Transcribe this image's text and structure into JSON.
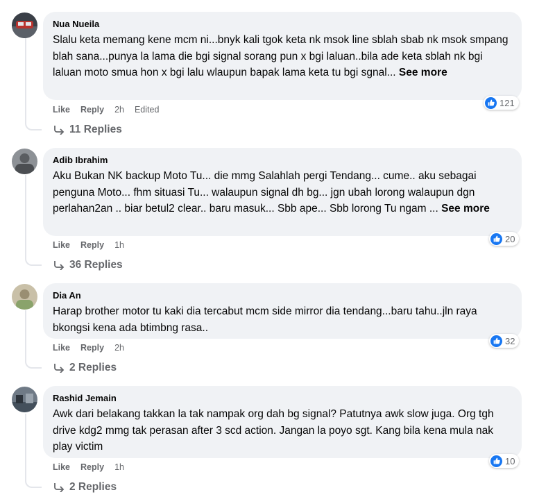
{
  "action_labels": {
    "like": "Like",
    "reply": "Reply"
  },
  "comments": [
    {
      "author": "Nua Nueila",
      "text": "Slalu keta memang kene mcm ni...bnyk kali tgok keta nk msok line sblah sbab nk msok smpang blah sana...punya la lama die bgi signal sorang pun x bgi laluan..bila ade keta sblah nk bgi laluan moto smua hon x bgi lalu wlaupun bapak lama keta tu bgi sgnal...",
      "see_more": "See more",
      "time": "2h",
      "edited": "Edited",
      "reactions": "121",
      "replies": "11 Replies"
    },
    {
      "author": "Adib Ibrahim",
      "text": "Aku Bukan NK backup Moto Tu... die mmg Salahlah pergi Tendang... cume.. aku sebagai penguna Moto... fhm situasi Tu... walaupun signal dh bg... jgn ubah lorong walaupun dgn perlahan2an .. biar betul2 clear.. baru masuk... Sbb ape... Sbb lorong Tu ngam ...",
      "see_more": "See more",
      "time": "1h",
      "reactions": "20",
      "replies": "36 Replies"
    },
    {
      "author": "Dia An",
      "text": "Harap brother motor tu kaki dia tercabut mcm side mirror dia tendang...baru tahu..jln raya bkongsi kena ada btimbng rasa..",
      "time": "2h",
      "reactions": "32",
      "replies": "2 Replies"
    },
    {
      "author": "Rashid Jemain",
      "text": "Awk dari belakang takkan la tak nampak org dah bg signal? Patutnya awk slow juga. Org tgh drive kdg2 mmg tak perasan after 3 scd action. Jangan la poyo sgt. Kang bila kena mula nak play victim",
      "time": "1h",
      "reactions": "10",
      "replies": "2 Replies"
    }
  ]
}
